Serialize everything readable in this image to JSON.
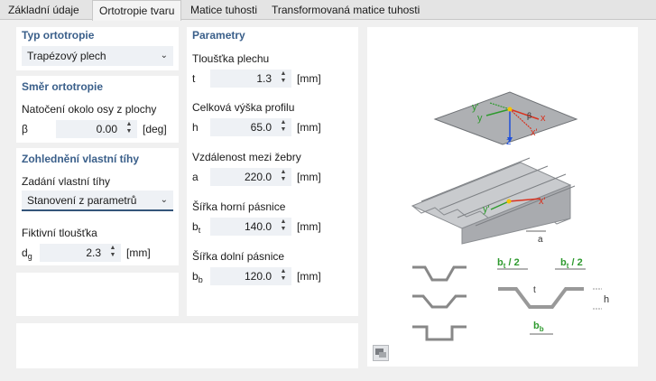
{
  "tabs": [
    "Základní údaje",
    "Ortotropie tvaru",
    "Matice tuhosti",
    "Transformovaná matice tuhosti"
  ],
  "typ": {
    "title": "Typ ortotropie",
    "value": "Trapézový plech"
  },
  "smer": {
    "title": "Směr ortotropie",
    "label": "Natočení okolo osy z plochy",
    "symbol": "β",
    "value": "0.00",
    "unit": "[deg]"
  },
  "tihy": {
    "title": "Zohlednění vlastní tíhy",
    "label": "Zadání vlastní tíhy",
    "value": "Stanovení z parametrů",
    "thickness_label": "Fiktivní tloušťka",
    "symbol": "d",
    "symbol_sub": "g",
    "thickness_value": "2.3",
    "unit": "[mm]"
  },
  "parametry": {
    "title": "Parametry",
    "items": [
      {
        "label": "Tloušťka plechu",
        "symbol": "t",
        "sub": "",
        "value": "1.3",
        "unit": "[mm]"
      },
      {
        "label": "Celková výška profilu",
        "symbol": "h",
        "sub": "",
        "value": "65.0",
        "unit": "[mm]"
      },
      {
        "label": "Vzdálenost mezi žebry",
        "symbol": "a",
        "sub": "",
        "value": "220.0",
        "unit": "[mm]"
      },
      {
        "label": "Šířka horní pásnice",
        "symbol": "b",
        "sub": "t",
        "value": "140.0",
        "unit": "[mm]"
      },
      {
        "label": "Šířka dolní pásnice",
        "symbol": "b",
        "sub": "b",
        "value": "120.0",
        "unit": "[mm]"
      }
    ]
  },
  "diagram": {
    "axis_labels": {
      "y_prime": "y'",
      "y": "y",
      "x": "x",
      "x_prime": "x'",
      "beta": "β",
      "z": "z"
    },
    "a_label": "a",
    "bt_half_left": "b",
    "bt_half_right": "b",
    "bt_sub": "t",
    "half": " / 2",
    "t_label": "t",
    "h_label": "h",
    "bb_label": "b",
    "bb_sub": "b"
  },
  "colors": {
    "accent": "#3a5f8a",
    "field": "#eef1f5",
    "green": "#2e9a2e",
    "red": "#d9321f",
    "blue": "#1f4fd9"
  }
}
